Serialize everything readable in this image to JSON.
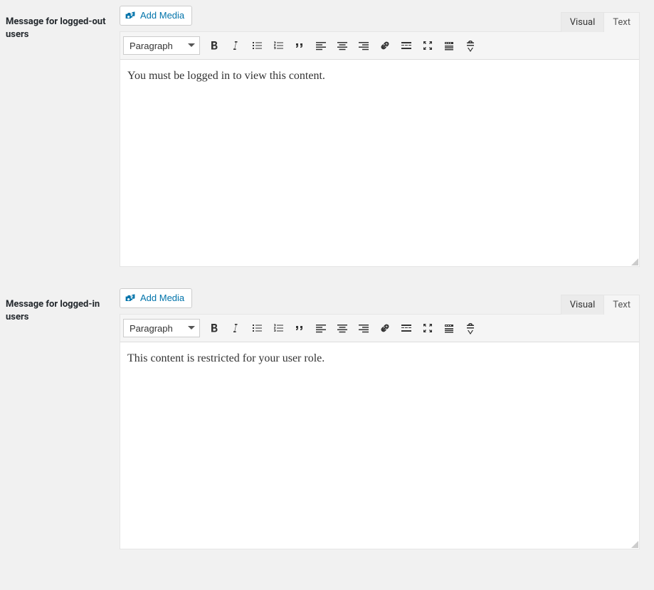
{
  "editors": [
    {
      "label": "Message for logged-out users",
      "add_media_label": "Add Media",
      "tabs": {
        "visual": "Visual",
        "text": "Text"
      },
      "format_select": "Paragraph",
      "content": "You must be logged in to view this content."
    },
    {
      "label": "Message for logged-in users",
      "add_media_label": "Add Media",
      "tabs": {
        "visual": "Visual",
        "text": "Text"
      },
      "format_select": "Paragraph",
      "content": "This content is restricted for your user role."
    }
  ]
}
